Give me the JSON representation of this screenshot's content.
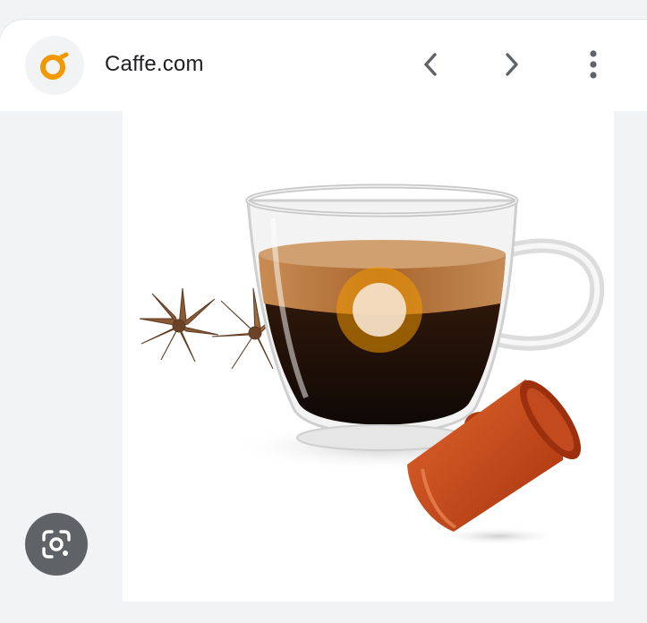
{
  "header": {
    "site_name": "Caffe.com",
    "logo_icon": "caffe-logo-icon",
    "back_icon": "chevron-left-icon",
    "forward_icon": "chevron-right-icon",
    "more_icon": "more-vert-icon"
  },
  "image": {
    "subject_icon": "espresso-cup-capsule-star-anise-image"
  },
  "lens": {
    "icon": "google-lens-icon"
  },
  "colors": {
    "logo_accent": "#f29900",
    "capsule": "#c4441c",
    "coffee": "#1a0f08",
    "crema": "#b9773d",
    "lens_button": "#5f6368"
  }
}
